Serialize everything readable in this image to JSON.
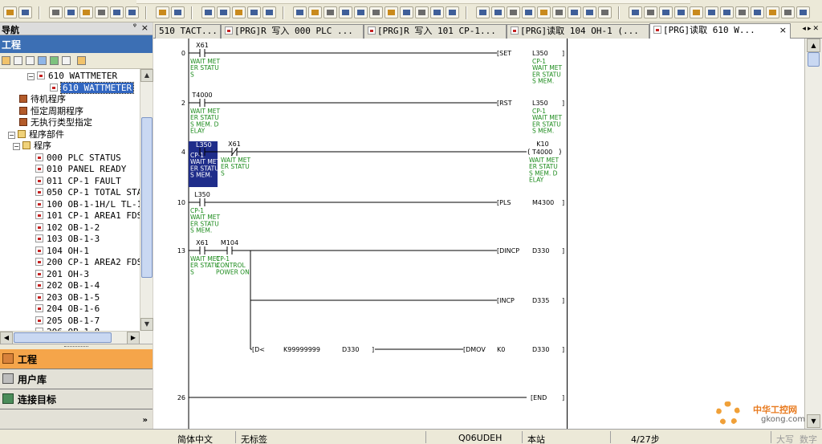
{
  "toolbar": {},
  "nav_panel": {
    "title": "导航",
    "pin_glyph": "ᵠ",
    "close_glyph": "×",
    "project_header": "工程",
    "tree": [
      {
        "label": "610 WATTMETER",
        "kind": "folder-prg",
        "mono": true
      },
      {
        "label": "610 WATTMETER",
        "kind": "prg",
        "mono": true,
        "selected": true
      },
      {
        "label": "待机程序",
        "kind": "book",
        "mono": false
      },
      {
        "label": "恒定周期程序",
        "kind": "book",
        "mono": false
      },
      {
        "label": "无执行类型指定",
        "kind": "book",
        "mono": false
      },
      {
        "label": "程序部件",
        "kind": "folder",
        "mono": false
      },
      {
        "label": "程序",
        "kind": "folder",
        "mono": false
      },
      {
        "label": "000 PLC STATUS",
        "kind": "prg",
        "mono": true
      },
      {
        "label": "010 PANEL READY",
        "kind": "prg",
        "mono": true
      },
      {
        "label": "011 CP-1 FAULT",
        "kind": "prg",
        "mono": true
      },
      {
        "label": "050 CP-1 TOTAL STA",
        "kind": "prg",
        "mono": true
      },
      {
        "label": "100 OB-1-1H/L TL-1",
        "kind": "prg",
        "mono": true
      },
      {
        "label": "101 CP-1 AREA1 FDS",
        "kind": "prg",
        "mono": true
      },
      {
        "label": "102 OB-1-2",
        "kind": "prg",
        "mono": true
      },
      {
        "label": "103 OB-1-3",
        "kind": "prg",
        "mono": true
      },
      {
        "label": "104 OH-1",
        "kind": "prg",
        "mono": true
      },
      {
        "label": "200 CP-1 AREA2 FDS",
        "kind": "prg",
        "mono": true
      },
      {
        "label": "201 OH-3",
        "kind": "prg",
        "mono": true
      },
      {
        "label": "202 OB-1-4",
        "kind": "prg",
        "mono": true
      },
      {
        "label": "203 OB-1-5",
        "kind": "prg",
        "mono": true
      },
      {
        "label": "204 OB-1-6",
        "kind": "prg",
        "mono": true
      },
      {
        "label": "205 OB-1-7",
        "kind": "prg",
        "mono": true
      },
      {
        "label": "206 OB-1-8",
        "kind": "prg",
        "mono": true
      }
    ],
    "bottom_tabs": [
      "工程",
      "用户库",
      "连接目标"
    ],
    "more_glyph": "»"
  },
  "doc_tabs": [
    {
      "label": "510 TACT...",
      "icon": false
    },
    {
      "label": "[PRG]R 写入 000 PLC ...",
      "icon": true
    },
    {
      "label": "[PRG]R 写入 101 CP-1...",
      "icon": true
    },
    {
      "label": "[PRG]读取 104 OH-1 (...",
      "icon": true
    },
    {
      "label": "[PRG]读取 610 W...",
      "icon": true,
      "active": true
    }
  ],
  "tab_close": "×",
  "tab_nav": "◂▸✕",
  "ladder": {
    "rungs": [
      {
        "step": "0",
        "contact": {
          "device": "X61",
          "comment": [
            "WAIT MET",
            "ER STATU",
            "S"
          ]
        },
        "instruction": "SET",
        "operand": "L350",
        "out_comment": [
          "CP-1",
          "WAIT MET",
          "ER STATU",
          "S MEM."
        ]
      },
      {
        "step": "2",
        "contact": {
          "device": "T4000",
          "comment": [
            "WAIT MET",
            "ER STATU",
            "S MEM. D",
            "ELAY"
          ]
        },
        "instruction": "RST",
        "operand": "L350",
        "out_comment": [
          "CP-1",
          "WAIT MET",
          "ER STATU",
          "S MEM."
        ]
      },
      {
        "step": "4",
        "contact": {
          "device": "L350",
          "comment": [
            "CP-1",
            "WAIT MET",
            "ER STATU",
            "S MEM."
          ]
        },
        "contact2": {
          "device": "X61",
          "comment": [
            "WAIT MET",
            "ER STATU",
            "S"
          ]
        },
        "coil": {
          "device": "T4000",
          "setting": "K10"
        },
        "out_comment": [
          "WAIT MET",
          "ER STATU",
          "S MEM. D",
          "ELAY"
        ]
      },
      {
        "step": "10",
        "contact": {
          "device": "L350",
          "comment": [
            "CP-1",
            "WAIT MET",
            "ER STATU",
            "S MEM."
          ]
        },
        "instruction": "PLS",
        "operand": "M4300"
      },
      {
        "step": "13",
        "contact": {
          "device": "X61",
          "comment": [
            "WAIT MET",
            "ER STATU",
            "S"
          ]
        },
        "contact2": {
          "device": "M104",
          "comment": [
            "CP-1",
            "CONTROL",
            "POWER ON"
          ]
        },
        "instruction": "DINCP",
        "operand": "D330",
        "branches": [
          {
            "instruction": "INCP",
            "operand": "D335"
          },
          {
            "compare": "D<",
            "cmp_op1": "K99999999",
            "cmp_op2": "D330",
            "instruction": "DMOV",
            "src": "K0",
            "operand": "D330"
          }
        ]
      },
      {
        "step": "26",
        "instruction": "END"
      }
    ]
  },
  "status": {
    "language": "简体中文",
    "label": "无标签",
    "cpu": "Q06UDEH",
    "station": "本站",
    "steps": "4/27步",
    "caps": "大写",
    "num": "数字"
  },
  "watermark": {
    "text": "中华工控网",
    "url": "gkong.com"
  }
}
